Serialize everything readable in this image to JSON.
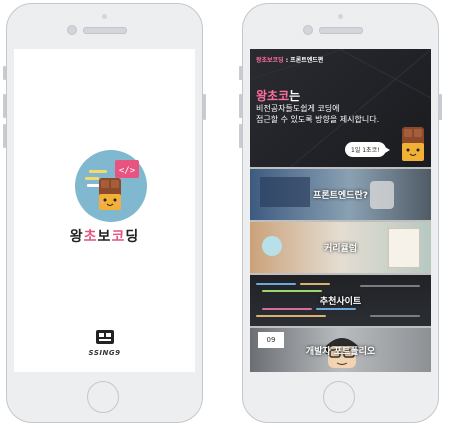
{
  "left_screen": {
    "app_name_part1": "왕",
    "app_name_pink": "초",
    "app_name_part2": "보",
    "app_name_pink2": "코",
    "app_name_part3": "딩",
    "logo_code_tag": "</>",
    "brand_text": "SSING9"
  },
  "right_screen": {
    "header_pink": "왕초보코딩",
    "header_rest": " : 프론트엔드편",
    "hero_title_pink": "왕초코",
    "hero_title_rest": "는",
    "hero_line1": "비전공자들도쉽게 코딩에",
    "hero_line2": "접근할 수 있도록 방향을 제시합니다.",
    "bubble_text": "1일 1초코!",
    "menu": [
      {
        "label": "프론트엔드란?"
      },
      {
        "label": "커리큘럼"
      },
      {
        "label": "추천사이트"
      },
      {
        "label": "개발자 포트폴리오"
      }
    ],
    "calendar_number": "09"
  },
  "colors": {
    "pink": "#ff6f9c",
    "logo_bg": "#7fb8cf",
    "chocolate": "#8b4a2b"
  }
}
